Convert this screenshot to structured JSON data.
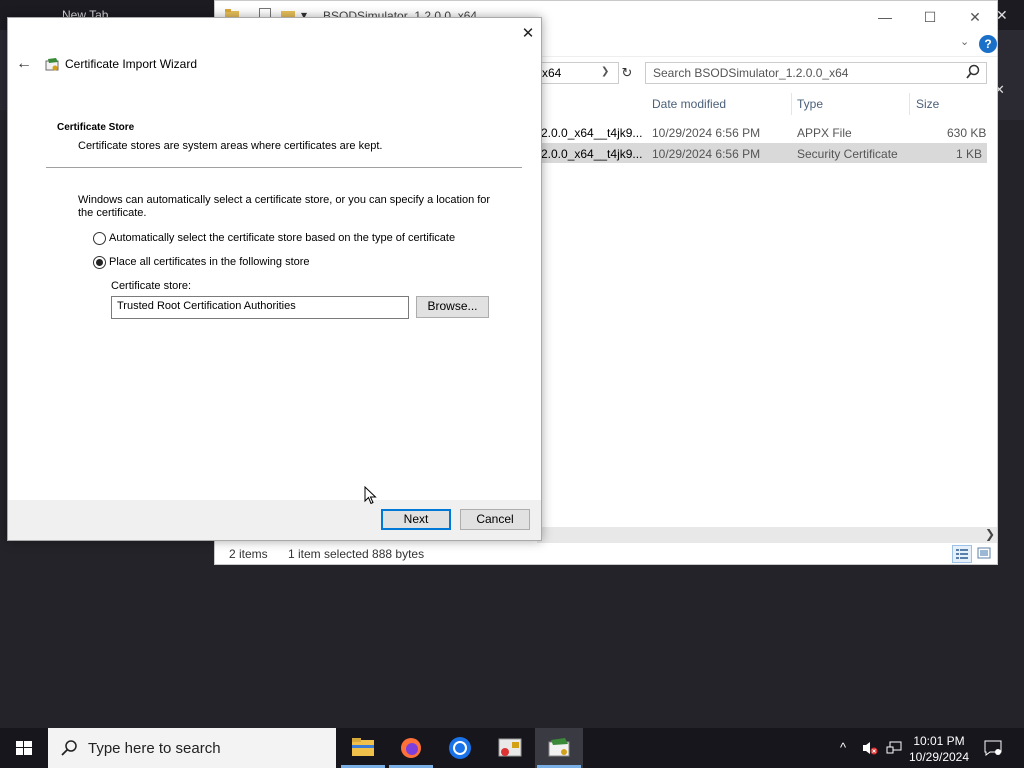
{
  "browser": {
    "tab_title": "New Tab"
  },
  "explorer": {
    "title": "BSODSimulator_1.2.0.0_x64",
    "address_fragment": "x64",
    "search_placeholder": "Search BSODSimulator_1.2.0.0_x64",
    "columns": {
      "date": "Date modified",
      "type": "Type",
      "size": "Size"
    },
    "files": [
      {
        "name": "2.0.0_x64__t4jk9...",
        "date": "10/29/2024 6:56 PM",
        "type": "APPX File",
        "size": "630 KB",
        "selected": false
      },
      {
        "name": "2.0.0_x64__t4jk9...",
        "date": "10/29/2024 6:56 PM",
        "type": "Security Certificate",
        "size": "1 KB",
        "selected": true
      }
    ],
    "status": {
      "items": "2 items",
      "selection": "1 item selected  888 bytes"
    }
  },
  "wizard": {
    "title": "Certificate Import Wizard",
    "section_heading": "Certificate Store",
    "section_desc": "Certificate stores are system areas where certificates are kept.",
    "explanation": "Windows can automatically select a certificate store, or you can specify a location for the certificate.",
    "radio_auto": "Automatically select the certificate store based on the type of certificate",
    "radio_manual": "Place all certificates in the following store",
    "store_label": "Certificate store:",
    "store_value": "Trusted Root Certification Authorities",
    "browse": "Browse...",
    "next": "Next",
    "cancel": "Cancel"
  },
  "taskbar": {
    "search_placeholder": "Type here to search",
    "time": "10:01 PM",
    "date": "10/29/2024"
  }
}
